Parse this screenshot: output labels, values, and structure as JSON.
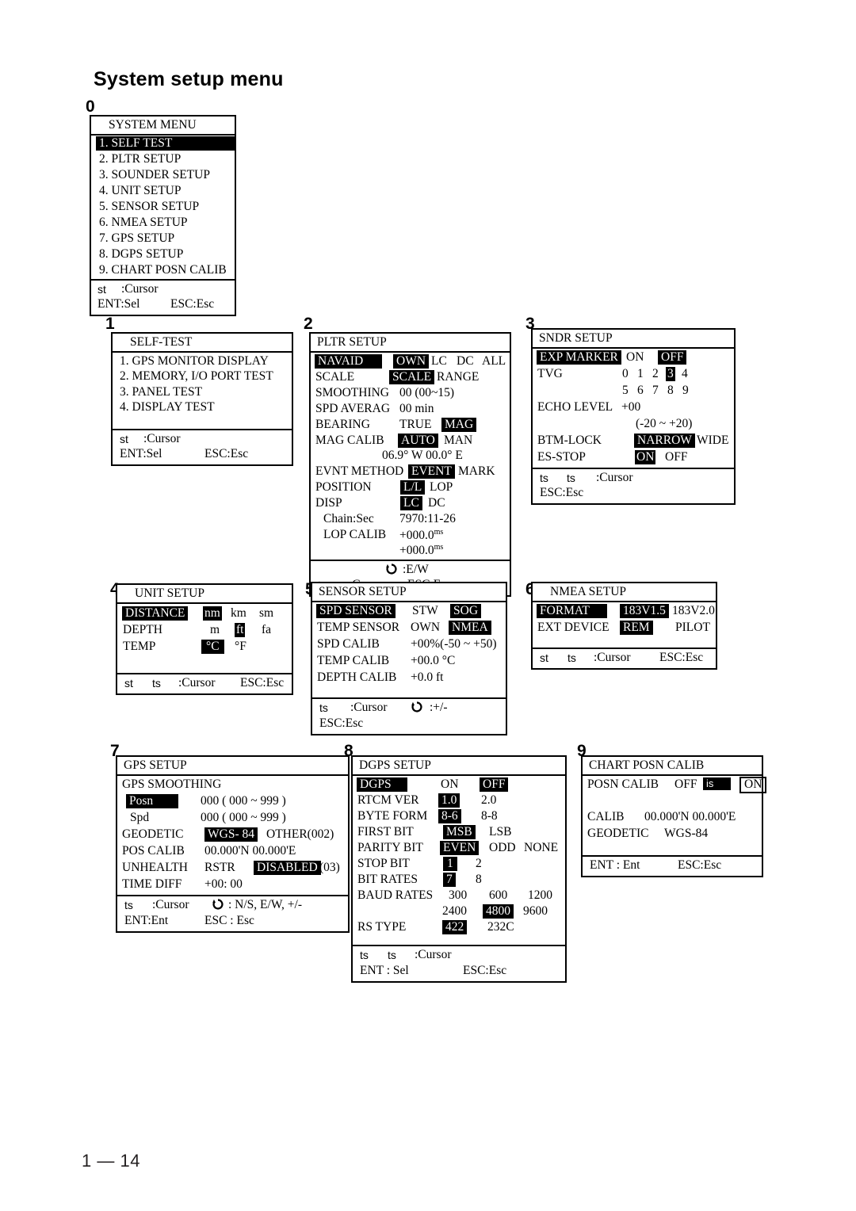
{
  "page": {
    "title": "System setup menu",
    "footer": "1 — 14"
  },
  "labels": {
    "n0": "0",
    "n1": "1",
    "n2": "2",
    "n3": "3",
    "n4": "4",
    "n5": "5",
    "n6": "6",
    "n7": "7",
    "n8": "8",
    "n9": "9"
  },
  "common": {
    "cursor_updown": "st",
    "cursor_leftright": "ts",
    "cursor_label": ":Cursor",
    "ent_sel": "ENT:Sel",
    "esc_esc": "ESC:Esc",
    "ent_sel_spaced": "ENT : Sel",
    "ent_ent": "ENT:Ent",
    "ent_ent_spaced": "ENT : Ent",
    "esc_esc_spaced": "ESC : Esc",
    "knob_icon": "rotary-knob-icon"
  },
  "system_menu": {
    "title": "SYSTEM MENU",
    "items": [
      {
        "label": "1. SELF TEST",
        "selected": true
      },
      {
        "label": "2. PLTR SETUP",
        "selected": false
      },
      {
        "label": "3. SOUNDER SETUP",
        "selected": false
      },
      {
        "label": "4. UNIT SETUP",
        "selected": false
      },
      {
        "label": "5. SENSOR SETUP",
        "selected": false
      },
      {
        "label": "6. NMEA SETUP",
        "selected": false
      },
      {
        "label": "7. GPS SETUP",
        "selected": false
      },
      {
        "label": "8. DGPS SETUP",
        "selected": false
      },
      {
        "label": "9. CHART POSN CALIB",
        "selected": false
      }
    ]
  },
  "self_test": {
    "title": "SELF-TEST",
    "items": [
      "1. GPS MONITOR DISPLAY",
      "2. MEMORY, I/O PORT TEST",
      "3. PANEL TEST",
      "4. DISPLAY TEST"
    ]
  },
  "pltr_setup": {
    "title": "PLTR SETUP",
    "navaid": {
      "label": "NAVAID",
      "options": [
        "OWN",
        "LC",
        "DC",
        "ALL"
      ],
      "selected": "OWN"
    },
    "scale": {
      "label": "SCALE",
      "options": [
        "SCALE",
        "RANGE"
      ],
      "selected": "SCALE"
    },
    "smoothing": {
      "label": "SMOOTHING",
      "value": "00 (00~15)"
    },
    "spd_averag": {
      "label": "SPD AVERAG",
      "value": "00 min"
    },
    "bearing": {
      "label": "BEARING",
      "options": [
        "TRUE",
        "MAG"
      ],
      "selected": "MAG"
    },
    "mag_calib": {
      "label": "MAG CALIB",
      "options": [
        "AUTO",
        "MAN"
      ],
      "selected": "AUTO",
      "value": "06.9° W  00.0° E"
    },
    "evnt_method": {
      "label": "EVNT METHOD",
      "options": [
        "EVENT",
        "MARK"
      ],
      "selected": "EVENT"
    },
    "position": {
      "label": "POSITION",
      "options": [
        "L/L",
        "LOP"
      ],
      "selected": "L/L"
    },
    "disp": {
      "label": "DISP",
      "options": [
        "LC",
        "DC"
      ],
      "selected": "LC"
    },
    "chain_sec": {
      "label": "Chain:Sec",
      "value": "7970:11-26"
    },
    "lop_calib": {
      "label": "LOP CALIB",
      "value1": "+000.0",
      "unit1": "ms",
      "value2": "+000.0",
      "unit2": "ms"
    },
    "knob_legend": ":E/W"
  },
  "sndr_setup": {
    "title": "SNDR SETUP",
    "exp_marker": {
      "label": "EXP MARKER",
      "options": [
        "ON",
        "OFF"
      ],
      "selected": "OFF"
    },
    "tvg": {
      "label": "TVG",
      "row1": [
        "0",
        "1",
        "2",
        "3",
        "4"
      ],
      "row2": [
        "5",
        "6",
        "7",
        "8",
        "9"
      ],
      "selected": "3"
    },
    "echo_level": {
      "label": "ECHO LEVEL",
      "value": "+00",
      "range": "(-20 ~ +20)"
    },
    "btm_lock": {
      "label": "BTM-LOCK",
      "options": [
        "NARROW",
        "WIDE"
      ],
      "selected": "NARROW"
    },
    "es_stop": {
      "label": "ES-STOP",
      "options": [
        "ON",
        "OFF"
      ],
      "selected": "ON"
    }
  },
  "unit_setup": {
    "title": "UNIT SETUP",
    "distance": {
      "label": "DISTANCE",
      "options": [
        "nm",
        "km",
        "sm"
      ],
      "selected": "nm"
    },
    "depth": {
      "label": "DEPTH",
      "options": [
        "m",
        "ft",
        "fa"
      ],
      "selected": "ft"
    },
    "temp": {
      "label": "TEMP",
      "options": [
        "°C",
        "°F"
      ],
      "selected": "°C"
    }
  },
  "sensor_setup": {
    "title": "SENSOR  SETUP",
    "spd_sensor": {
      "label": "SPD SENSOR",
      "options": [
        "STW",
        "SOG"
      ],
      "selected": "SOG"
    },
    "temp_sensor": {
      "label": "TEMP SENSOR",
      "options": [
        "OWN",
        "NMEA"
      ],
      "selected": "NMEA"
    },
    "spd_calib": {
      "label": "SPD CALIB",
      "value": "+00%(-50 ~ +50)"
    },
    "temp_calib": {
      "label": "TEMP CALIB",
      "value": "+00.0 °C"
    },
    "depth_calib": {
      "label": "DEPTH CALIB",
      "value": "+0.0 ft"
    },
    "knob_legend": ":+/-"
  },
  "nmea_setup": {
    "title": "NMEA SETUP",
    "format": {
      "label": "FORMAT",
      "options": [
        "183V1.5",
        "183V2.0"
      ],
      "selected": "183V1.5"
    },
    "ext_device": {
      "label": "EXT DEVICE",
      "options": [
        "REM",
        "PILOT"
      ],
      "selected": "REM"
    }
  },
  "gps_setup": {
    "title": "GPS SETUP",
    "smoothing_header": "GPS SMOOTHING",
    "posn": {
      "label": "Posn",
      "value": "000 ( 000 ~ 999 )",
      "selected": true
    },
    "spd": {
      "label": "Spd",
      "value": "000 ( 000 ~ 999 )",
      "selected": false
    },
    "geodetic": {
      "label": "GEODETIC",
      "options": [
        "WGS- 84",
        "OTHER(002)"
      ],
      "selected": "WGS- 84"
    },
    "pos_calib": {
      "label": "POS CALIB",
      "value": "00.000'N   00.000'E"
    },
    "unhealth": {
      "label": "UNHEALTH",
      "options": [
        "RSTR",
        "DISABLED"
      ],
      "selected": "DISABLED",
      "suffix": "(03)"
    },
    "time_diff": {
      "label": "TIME DIFF",
      "value": "+00: 00"
    },
    "knob_legend": ": N/S, E/W, +/-"
  },
  "dgps_setup": {
    "title": "DGPS SETUP",
    "dgps": {
      "label": "DGPS",
      "options": [
        "ON",
        "OFF"
      ],
      "selected": "OFF"
    },
    "rtcm_ver": {
      "label": "RTCM VER",
      "options": [
        "1.0",
        "2.0"
      ],
      "selected": "1.0"
    },
    "byte_form": {
      "label": "BYTE FORM",
      "options": [
        "8-6",
        "8-8"
      ],
      "selected": "8-6"
    },
    "first_bit": {
      "label": "FIRST BIT",
      "options": [
        "MSB",
        "LSB"
      ],
      "selected": "MSB"
    },
    "parity_bit": {
      "label": "PARITY BIT",
      "options": [
        "EVEN",
        "ODD",
        "NONE"
      ],
      "selected": "EVEN"
    },
    "stop_bit": {
      "label": "STOP BIT",
      "options": [
        "1",
        "2"
      ],
      "selected": "1"
    },
    "bit_rates": {
      "label": "BIT RATES",
      "options": [
        "7",
        "8"
      ],
      "selected": "7"
    },
    "baud_rates": {
      "label": "BAUD RATES",
      "row1": [
        "300",
        "600",
        "1200"
      ],
      "row2": [
        "2400",
        "4800",
        "9600"
      ],
      "selected": "4800"
    },
    "rs_type": {
      "label": "RS TYPE",
      "options": [
        "422",
        "232C"
      ],
      "selected": "422"
    }
  },
  "chart_posn_calib": {
    "title": "CHART POSN CALIB",
    "posn_calib": {
      "label": "POSN CALIB",
      "off": "OFF",
      "cursor": "is",
      "on": "ON"
    },
    "calib": {
      "label": "CALIB",
      "value": "00.000'N  00.000'E"
    },
    "geodetic": {
      "label": "GEODETIC",
      "value": "WGS-84"
    }
  }
}
